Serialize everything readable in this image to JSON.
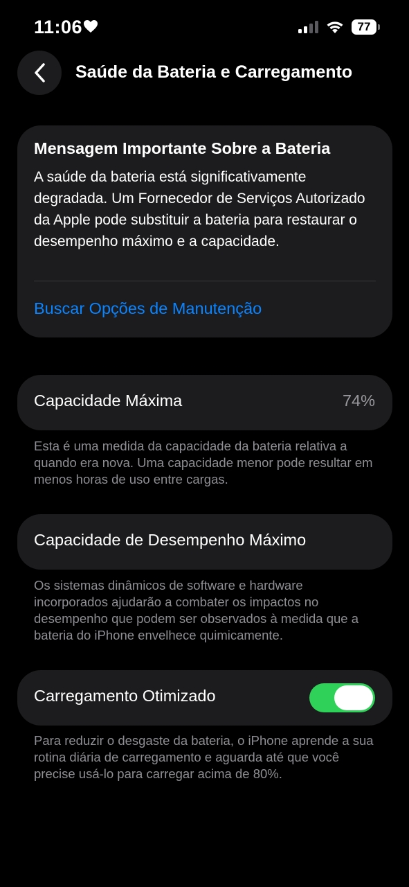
{
  "status_bar": {
    "time": "11:06",
    "battery_level": "77",
    "icons": [
      "heart-icon",
      "cellular-signal-icon",
      "wifi-icon",
      "battery-icon"
    ]
  },
  "nav": {
    "title": "Saúde da Bateria e Carregamento",
    "back_icon": "chevron-left-icon"
  },
  "message_card": {
    "title": "Mensagem Importante Sobre a Bateria",
    "body": "A saúde da bateria está significativamente degradada. Um Fornecedor de Serviços Autorizado da Apple pode substituir a bateria para restaurar o desempenho máximo e a capacidade.",
    "link": "Buscar Opções de Manutenção"
  },
  "max_capacity": {
    "label": "Capacidade Máxima",
    "value": "74%",
    "footnote": "Esta é uma medida da capacidade da bateria relativa a quando era nova. Uma capacidade menor pode resultar em menos horas de uso entre cargas."
  },
  "peak_performance": {
    "label": "Capacidade de Desempenho Máximo",
    "footnote": "Os sistemas dinâmicos de software e hardware incorporados ajudarão a combater os impactos no desempenho que podem ser observados à medida que a bateria do iPhone envelhece quimicamente."
  },
  "optimized_charging": {
    "label": "Carregamento Otimizado",
    "enabled": true,
    "footnote": "Para reduzir o desgaste da bateria, o iPhone aprende a sua rotina diária de carregamento e aguarda até que você precise usá-lo para carregar acima de 80%."
  },
  "colors": {
    "background": "#000000",
    "card": "#1c1c1e",
    "link": "#0a84ff",
    "toggle_on": "#30d158",
    "secondary_text": "#8e8e93"
  }
}
